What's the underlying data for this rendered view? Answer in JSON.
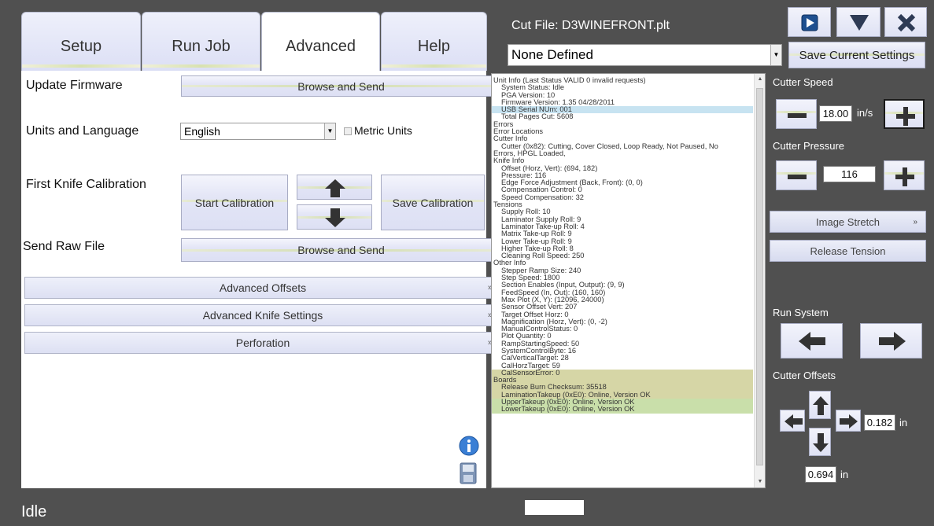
{
  "tabs": [
    {
      "label": "Setup"
    },
    {
      "label": "Run Job"
    },
    {
      "label": "Advanced"
    },
    {
      "label": "Help"
    }
  ],
  "advanced": {
    "update_firmware_label": "Update Firmware",
    "browse_send_1": "Browse and Send",
    "units_language_label": "Units and Language",
    "language_value": "English",
    "metric_units_label": "Metric Units",
    "first_knife_label": "First Knife Calibration",
    "start_calibration": "Start Calibration",
    "save_calibration": "Save Calibration",
    "send_raw_label": "Send Raw File",
    "browse_send_2": "Browse and Send",
    "sections": [
      "Advanced Offsets",
      "Advanced Knife Settings",
      "Perforation"
    ]
  },
  "header": {
    "cut_file": "Cut File: D3WINEFRONT.plt",
    "settings_value": "None Defined",
    "save_settings": "Save Current Settings"
  },
  "info_lines": [
    {
      "t": "Unit Info (Last Status VALID 0 invalid requests)",
      "c": "h"
    },
    {
      "t": "System Status: Idle",
      "c": ""
    },
    {
      "t": "PGA Version: 10",
      "c": ""
    },
    {
      "t": "Firmware Version: 1.35 04/28/2011",
      "c": ""
    },
    {
      "t": "USB Serial NUm: 001",
      "c": "sel"
    },
    {
      "t": "Total Pages Cut: 5608",
      "c": ""
    },
    {
      "t": "Errors",
      "c": "h"
    },
    {
      "t": "Error Locations",
      "c": "h"
    },
    {
      "t": "Cutter Info",
      "c": "h"
    },
    {
      "t": "Cutter (0x82): Cutting, Cover Closed, Loop Ready, Not Paused, No",
      "c": ""
    },
    {
      "t": "Errors, HPGL Loaded,",
      "c": "h"
    },
    {
      "t": "Knife Info",
      "c": "h"
    },
    {
      "t": "Offset (Horz, Vert): (694, 182)",
      "c": ""
    },
    {
      "t": "Pressure: 116",
      "c": ""
    },
    {
      "t": "Edge Force Adjustment (Back, Front): (0, 0)",
      "c": ""
    },
    {
      "t": "Compensation Control: 0",
      "c": ""
    },
    {
      "t": "Speed Compensation: 32",
      "c": ""
    },
    {
      "t": "Tensions",
      "c": "h"
    },
    {
      "t": "Supply Roll: 10",
      "c": ""
    },
    {
      "t": "Laminator Supply Roll: 9",
      "c": ""
    },
    {
      "t": "Laminator Take-up Roll: 4",
      "c": ""
    },
    {
      "t": "Matrix Take-up Roll: 9",
      "c": ""
    },
    {
      "t": "Lower Take-up Roll: 9",
      "c": ""
    },
    {
      "t": "Higher Take-up Roll: 8",
      "c": ""
    },
    {
      "t": "Cleaning Roll Speed: 250",
      "c": ""
    },
    {
      "t": "Other Info",
      "c": "h"
    },
    {
      "t": "Stepper Ramp Size: 240",
      "c": ""
    },
    {
      "t": "Step Speed: 1800",
      "c": ""
    },
    {
      "t": "Section Enables (Input, Output): (9, 9)",
      "c": ""
    },
    {
      "t": "FeedSpeed (In, Out): (160, 160)",
      "c": ""
    },
    {
      "t": "Max Plot (X, Y): (12096, 24000)",
      "c": ""
    },
    {
      "t": "Sensor Offset Vert: 207",
      "c": ""
    },
    {
      "t": "Target Offset Horz: 0",
      "c": ""
    },
    {
      "t": "Magnification (Horz, Vert): (0, -2)",
      "c": ""
    },
    {
      "t": "ManualControlStatus: 0",
      "c": ""
    },
    {
      "t": "Plot Quantity: 0",
      "c": ""
    },
    {
      "t": "RampStartingSpeed: 50",
      "c": ""
    },
    {
      "t": "SystemControlByte: 16",
      "c": ""
    },
    {
      "t": "CalVerticalTarget: 28",
      "c": ""
    },
    {
      "t": "CalHorzTarget: 59",
      "c": ""
    },
    {
      "t": "CalSensorError: 0",
      "c": "warn"
    },
    {
      "t": "Boards",
      "c": "h warn"
    },
    {
      "t": "Release Burn Checksum: 35518",
      "c": "warn"
    },
    {
      "t": "LaminationTakeup (0xE0): Online, Version OK",
      "c": "warn"
    },
    {
      "t": "UpperTakeup (0xE0): Online, Version OK",
      "c": "ok"
    },
    {
      "t": "LowerTakeup (0xE0): Online, Version OK",
      "c": "ok"
    }
  ],
  "right": {
    "cutter_speed_label": "Cutter Speed",
    "cutter_speed_value": "18.00",
    "cutter_speed_unit": "in/s",
    "cutter_pressure_label": "Cutter Pressure",
    "cutter_pressure_value": "116",
    "image_stretch": "Image Stretch",
    "release_tension": "Release Tension",
    "run_system_label": "Run System",
    "cutter_offsets_label": "Cutter Offsets",
    "offset_h_value": "0.182",
    "offset_h_unit": "in",
    "offset_v_value": "0.694",
    "offset_v_unit": "in"
  },
  "status": {
    "text": "Idle"
  },
  "colors": {
    "background": "#505050",
    "panel": "#ffffff",
    "accent": "#d8e2b0"
  }
}
